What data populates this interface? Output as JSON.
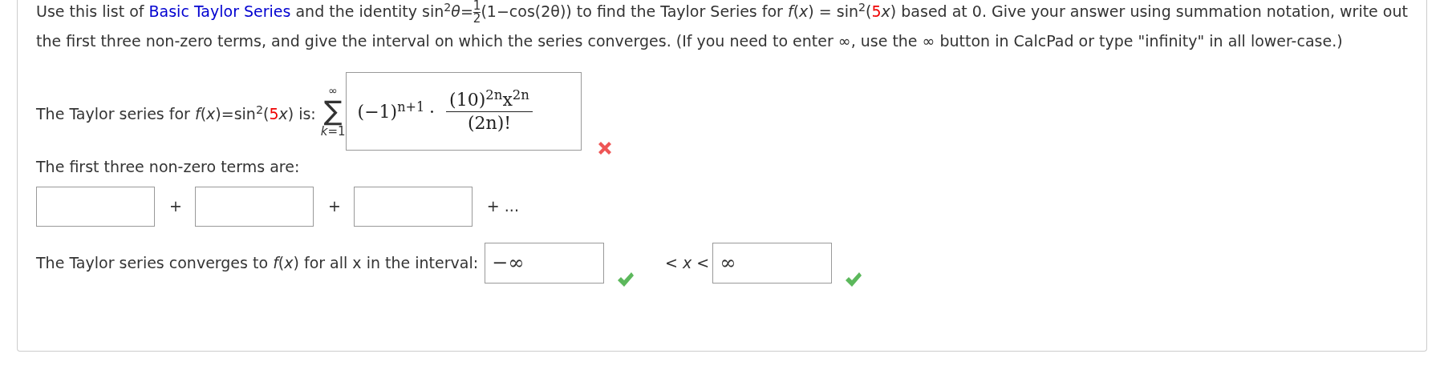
{
  "instructions": [
    {
      "kind": "text",
      "text": "Use this list of "
    },
    {
      "kind": "link",
      "text": "Basic Taylor Series"
    },
    {
      "kind": "text",
      "text": " and the identity  "
    },
    {
      "kind": "math",
      "text": "sin$^{2}$*θ*="
    },
    {
      "kind": "fraction",
      "numerator": "1",
      "denominator": "2"
    },
    {
      "kind": "math",
      "text": "(1−cos(2θ))"
    },
    {
      "kind": "text",
      "text": "  to find the Taylor Series for  "
    },
    {
      "kind": "math",
      "text": "*f*(*x*) = sin$^{2}$("
    },
    {
      "kind": "accent",
      "text": "5"
    },
    {
      "kind": "math",
      "text": "*x*)"
    },
    {
      "kind": "text",
      "text": "  based at 0. Give your answer using summation notation, write out the first three non-zero terms, and give the interval on which the series converges. (If you need to enter ∞, use the ∞ button in CalcPad or type \"infinity\" in all lower-case.)"
    }
  ],
  "series": {
    "label": "The Taylor series for  *f*(*x*)=sin$^{2}$(",
    "label_accent": "5",
    "label_end": "*x*) is:",
    "sum_upper": "∞",
    "sum_symbol": "∑",
    "sum_lower": "*k*=1",
    "answer": {
      "base": "(−1)",
      "exponent": "n+1",
      "operator": "·",
      "numerator": "(10)$^{2n}$x$^{2n}$",
      "denominator": "(2n)!"
    },
    "correct": false
  },
  "terms": {
    "label": "The first three non-zero terms are:",
    "fields": [
      {
        "joiner": "+"
      },
      {
        "joiner": "+"
      },
      {
        "joiner": "+ ..."
      }
    ]
  },
  "interval": {
    "label": "The Taylor series converges to  *f*(*x*)  for all x in the interval:",
    "lower": {
      "value": "−∞",
      "correct": true
    },
    "middle": "< *x* <",
    "upper": {
      "value": "∞",
      "correct": true
    }
  }
}
